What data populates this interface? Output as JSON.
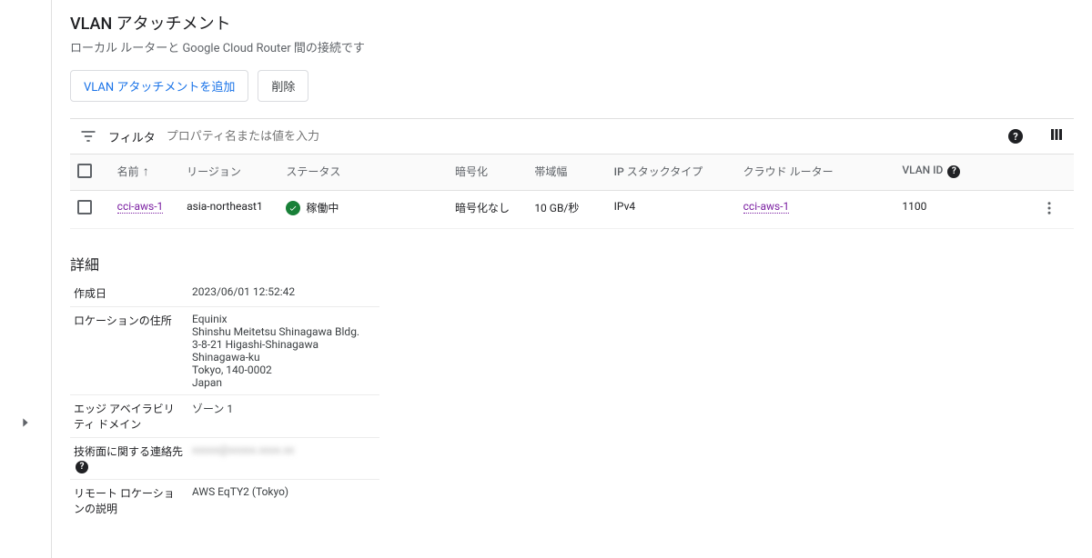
{
  "page": {
    "title": "VLAN アタッチメント",
    "subtitle": "ローカル ルーターと Google Cloud Router 間の接続です"
  },
  "actions": {
    "add_label": "VLAN アタッチメントを追加",
    "delete_label": "削除"
  },
  "filter": {
    "label": "フィルタ",
    "placeholder": "プロパティ名または値を入力"
  },
  "columns": {
    "name": "名前",
    "region": "リージョン",
    "status": "ステータス",
    "encryption": "暗号化",
    "bandwidth": "帯域幅",
    "ip_stack": "IP スタックタイプ",
    "cloud_router": "クラウド ルーター",
    "vlan_id": "VLAN ID"
  },
  "rows": [
    {
      "name": "cci-aws-1",
      "region": "asia-northeast1",
      "status": "稼働中",
      "encryption": "暗号化なし",
      "bandwidth": "10 GB/秒",
      "ip_stack": "IPv4",
      "cloud_router": "cci-aws-1",
      "vlan_id": "1100"
    }
  ],
  "details": {
    "heading": "詳細",
    "created_at_label": "作成日",
    "created_at": "2023/06/01 12:52:42",
    "location_label": "ロケーションの住所",
    "location_line1": "Equinix",
    "location_line2": "Shinshu Meitetsu Shinagawa Bldg.",
    "location_line3": "3-8-21 Higashi-Shinagawa Shinagawa-ku",
    "location_line4": "Tokyo, 140-0002",
    "location_line5": "Japan",
    "edge_domain_label": "エッジ アベイラビリティ ドメイン",
    "edge_domain": "ゾーン 1",
    "tech_contact_label": "技術面に関する連絡先",
    "tech_contact": "xxxxx@xxxxx.xxxx.xx",
    "remote_loc_label": "リモート ロケーションの説明",
    "remote_loc": "AWS EqTY2 (Tokyo)"
  }
}
